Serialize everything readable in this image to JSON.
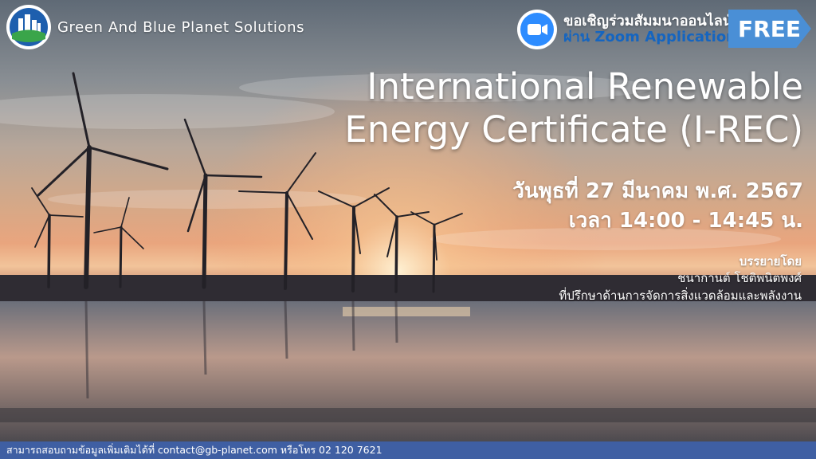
{
  "brand": {
    "name": "Green And Blue Planet Solutions",
    "logo_icon": "city-planet-logo-icon"
  },
  "zoom": {
    "invite": "ขอเชิญร่วมสัมมนาออนไลน์",
    "via": "ผ่าน Zoom Application",
    "icon": "zoom-camera-icon"
  },
  "badge": {
    "free": "FREE"
  },
  "title": {
    "line1": "International Renewable",
    "line2": "Energy Certificate (I-REC)"
  },
  "event": {
    "date": "วันพุธที่ 27 มีนาคม พ.ศ. 2567",
    "time": "เวลา 14:00 - 14:45 น."
  },
  "speaker": {
    "label": "บรรยายโดย",
    "name": "ชนากานต์ โชติพนิตพงศ์",
    "role": "ที่ปรึกษาด้านการจัดการสิ่งแวดล้อมและพลังงาน"
  },
  "footer": {
    "text": "สามารถสอบถามข้อมูลเพิ่มเติมได้ที่ contact@gb-planet.com หรือโทร 02 120 7621"
  },
  "colors": {
    "footer_bg": "#3f5fa3",
    "zoom_blue": "#1565c0",
    "free_bg": "#4a8fd6"
  }
}
